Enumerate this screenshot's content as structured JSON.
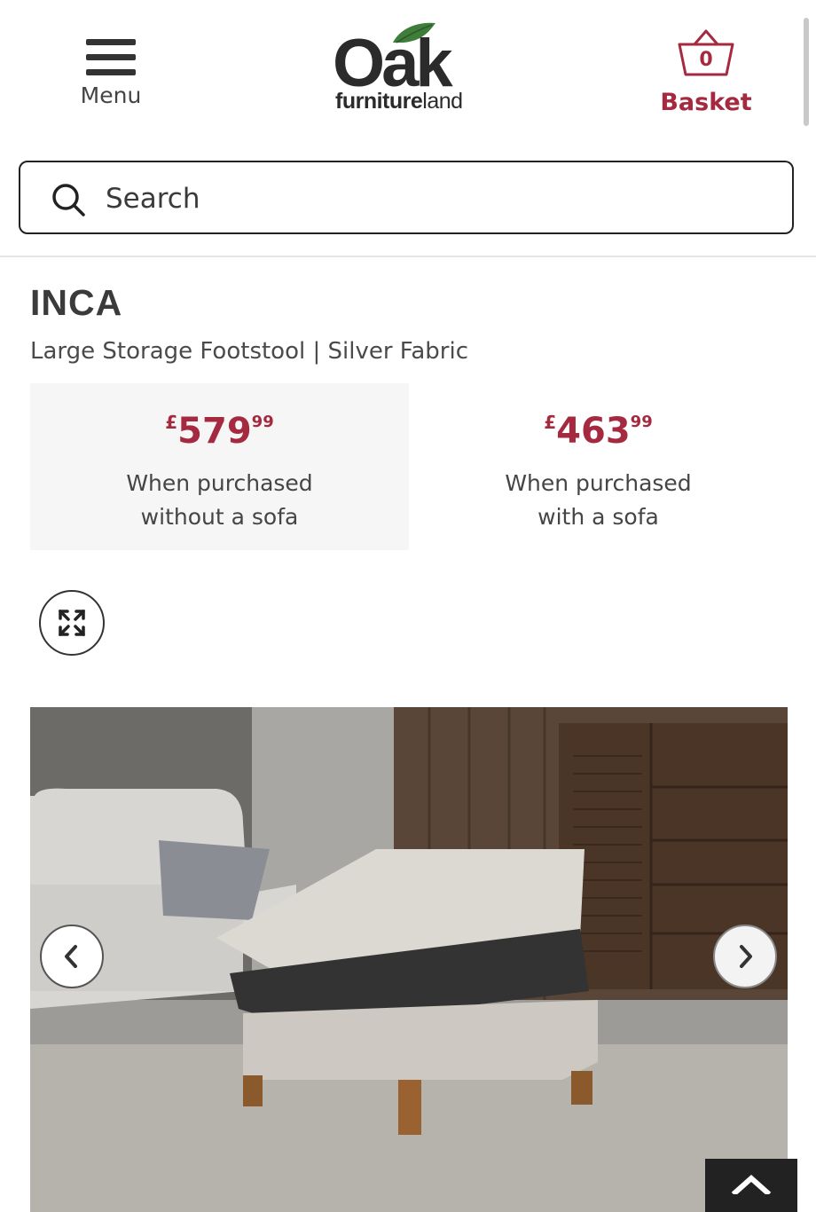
{
  "header": {
    "menu_label": "Menu",
    "logo_main": "Oak",
    "logo_sub_bold": "furniture",
    "logo_sub_light": "land",
    "basket_label": "Basket",
    "basket_count": "0"
  },
  "search": {
    "placeholder": "Search"
  },
  "product": {
    "brand": "INCA",
    "subtitle": "Large Storage Footstool | Silver Fabric"
  },
  "prices": [
    {
      "currency": "£",
      "amount": "579",
      "pence": "99",
      "note_line1": "When purchased",
      "note_line2": "without a sofa"
    },
    {
      "currency": "£",
      "amount": "463",
      "pence": "99",
      "note_line1": "When purchased",
      "note_line2": "with a sofa"
    }
  ],
  "icons": {
    "menu": "hamburger-icon",
    "basket": "basket-icon",
    "search": "search-icon",
    "expand": "expand-icon",
    "prev": "chevron-left-icon",
    "next": "chevron-right-icon",
    "back_to_top": "chevron-up-icon"
  },
  "colors": {
    "accent": "#a52a3f",
    "text": "#3a3a3a",
    "shaded_bg": "#f6f6f6"
  }
}
